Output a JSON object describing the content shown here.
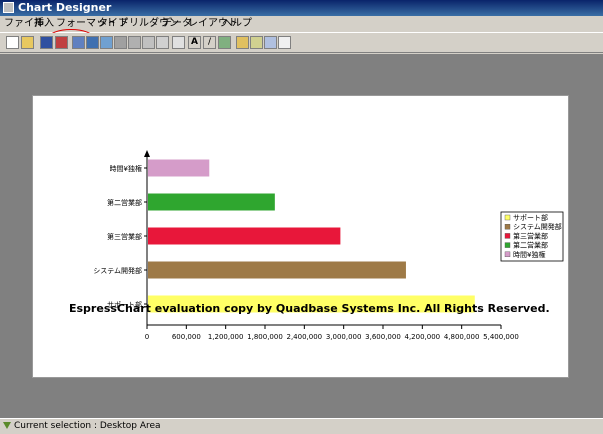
{
  "window": {
    "title": "Chart Designer"
  },
  "menu": [
    "ファイル",
    "挿入",
    "フォーマット",
    "タイプ",
    "ドリルダウン",
    "データ",
    "レイアウト",
    "ヘルプ"
  ],
  "toolbar_icons": [
    "new-file-icon",
    "open-folder-icon",
    "save-icon",
    "export-icon",
    "data-source-icon",
    "chart-type-icon",
    "3d-icon",
    "grid-icon",
    "axis-icon",
    "legend-icon",
    "table-icon",
    "text-icon",
    "draw-icon",
    "image-icon",
    "zoom-in-icon",
    "zoom-out-icon",
    "refresh-icon",
    "properties-icon"
  ],
  "chart_data": {
    "type": "bar",
    "orientation": "horizontal",
    "categories": [
      "サポート部",
      "システム開発部",
      "第三営業部",
      "第二営業部",
      "時間¥独権"
    ],
    "values": [
      5000000,
      3950000,
      2950000,
      1950000,
      950000
    ],
    "colors": [
      "#ffff66",
      "#9e7a47",
      "#e8173a",
      "#2fa62f",
      "#d59cc9"
    ],
    "x_ticks": [
      "0",
      "600,000",
      "1,200,000",
      "1,800,000",
      "2,400,000",
      "3,000,000",
      "3,600,000",
      "4,200,000",
      "4,800,000",
      "5,400,000"
    ],
    "xlim": [
      0,
      5400000
    ],
    "legend": [
      "サポート部",
      "システム開発部",
      "第三営業部",
      "第二営業部",
      "時間¥独権"
    ],
    "legend_position": "right",
    "watermark": "EspressChart evaluation copy by Quadbase Systems Inc. All Rights Reserved."
  },
  "status": {
    "text": "Current selection : Desktop Area"
  }
}
